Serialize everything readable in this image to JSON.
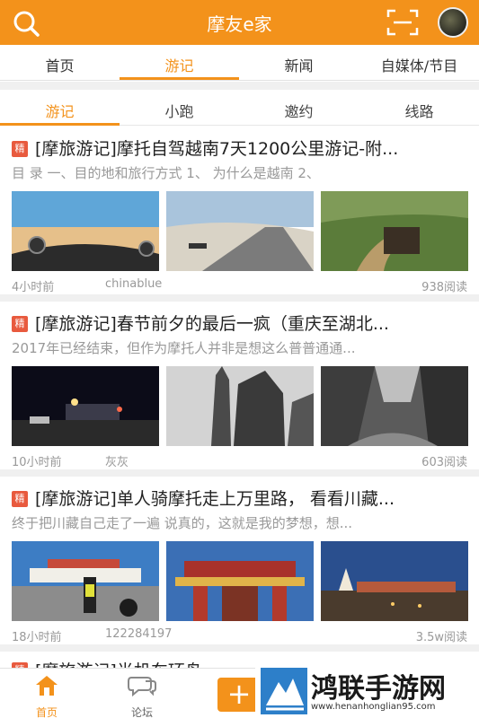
{
  "header": {
    "title": "摩友e家"
  },
  "main_tabs": [
    {
      "label": "首页"
    },
    {
      "label": "游记"
    },
    {
      "label": "新闻"
    },
    {
      "label": "自媒体/节目"
    }
  ],
  "sub_tabs": [
    {
      "label": "游记"
    },
    {
      "label": "小跑"
    },
    {
      "label": "邀约"
    },
    {
      "label": "线路"
    }
  ],
  "posts": [
    {
      "badge": "精",
      "title": "[摩旅游记]摩托自驾越南7天1200公里游记-附...",
      "excerpt": "目 录  一、目的地和旅行方式 1、    为什么是越南  2、",
      "time": "4小时前",
      "author": "chinablue",
      "reads": "938阅读"
    },
    {
      "badge": "精",
      "title": "[摩旅游记]春节前夕的最后一疯（重庆至湖北...",
      "excerpt": "2017年已经结束，但作为摩托人并非是想这么普普通通...",
      "time": "10小时前",
      "author": "灰灰",
      "reads": "603阅读"
    },
    {
      "badge": "精",
      "title": "[摩旅游记]单人骑摩托走上万里路， 看看川藏...",
      "excerpt": "终于把川藏自己走了一遍  说真的，这就是我的梦想，想...",
      "time": "18小时前",
      "author": "122284197",
      "reads": "3.5w阅读"
    },
    {
      "badge": "精",
      "title": "[摩旅游记]半机车环岛..."
    }
  ],
  "bottom_nav": [
    {
      "label": "首页"
    },
    {
      "label": "论坛"
    }
  ],
  "watermark": {
    "text": "鸿联手游网",
    "url": "www.henanhonglian95.com"
  },
  "colors": {
    "accent": "#f3921b",
    "badge": "#e85a3e"
  }
}
